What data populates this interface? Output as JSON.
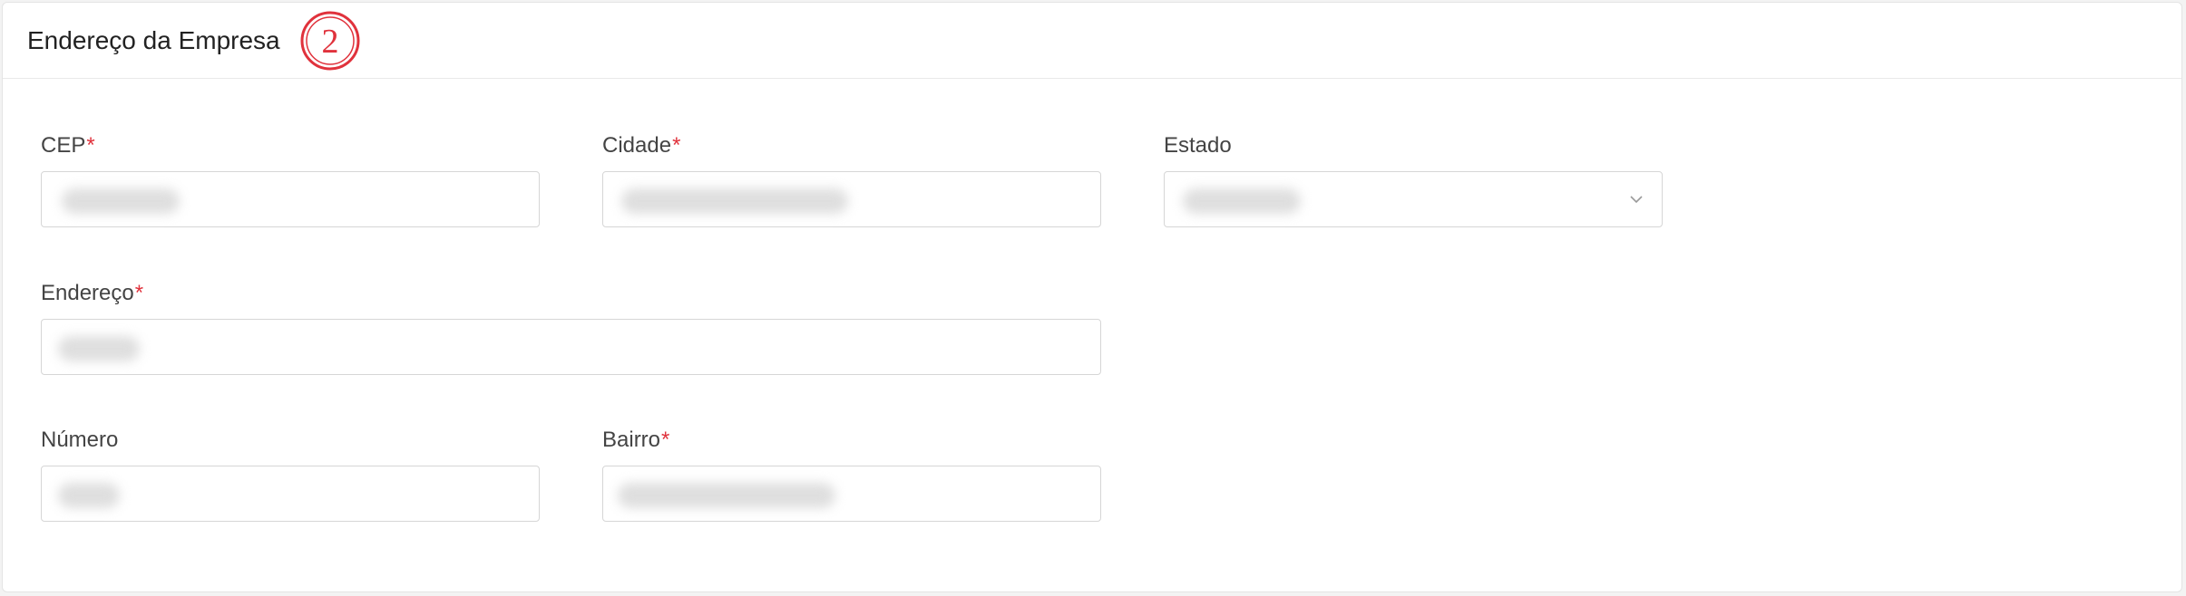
{
  "section": {
    "title": "Endereço da Empresa",
    "step_number": "2",
    "step_color": "#e0323c"
  },
  "required_marker": "*",
  "fields": {
    "cep": {
      "label": "CEP",
      "required": true,
      "value": ""
    },
    "cidade": {
      "label": "Cidade",
      "required": true,
      "value": ""
    },
    "estado": {
      "label": "Estado",
      "required": false,
      "value": "",
      "icon": "chevron-down-icon"
    },
    "endereco": {
      "label": "Endereço",
      "required": true,
      "value": ""
    },
    "numero": {
      "label": "Número",
      "required": false,
      "value": ""
    },
    "bairro": {
      "label": "Bairro",
      "required": true,
      "value": ""
    }
  }
}
